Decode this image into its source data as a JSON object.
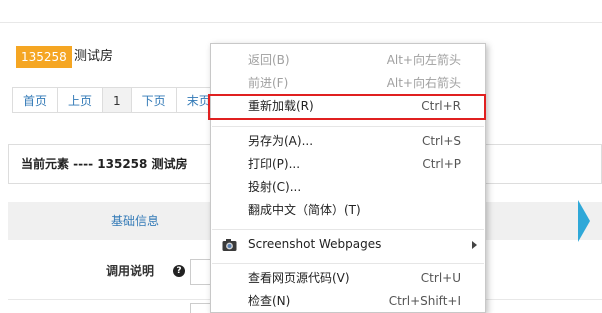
{
  "room": {
    "id_badge": "135258",
    "name": "测试房"
  },
  "pager": {
    "first": "首页",
    "prev": "上页",
    "current": "1",
    "next": "下页",
    "last_partial": "末页"
  },
  "current_element": {
    "text": "当前元素 ---- 135258 测试房"
  },
  "tabs": {
    "basic_info": "基础信息"
  },
  "form": {
    "usage_label": "调用说明",
    "help_icon_glyph": "?"
  },
  "context_menu": {
    "items": [
      {
        "label": "返回(B)",
        "shortcut": "Alt+向左箭头",
        "disabled": true
      },
      {
        "label": "前进(F)",
        "shortcut": "Alt+向右箭头",
        "disabled": true
      },
      {
        "label": "重新加载(R)",
        "shortcut": "Ctrl+R",
        "disabled": false,
        "highlighted": true
      },
      {
        "label": "另存为(A)...",
        "shortcut": "Ctrl+S",
        "disabled": false
      },
      {
        "label": "打印(P)...",
        "shortcut": "Ctrl+P",
        "disabled": false
      },
      {
        "label": "投射(C)...",
        "shortcut": "",
        "disabled": false
      },
      {
        "label": "翻成中文（简体）(T)",
        "shortcut": "",
        "disabled": false
      },
      {
        "label": "Screenshot Webpages",
        "shortcut": "",
        "disabled": false,
        "icon": "camera-icon",
        "submenu": true
      },
      {
        "label": "查看网页源代码(V)",
        "shortcut": "Ctrl+U",
        "disabled": false
      },
      {
        "label": "检查(N)",
        "shortcut": "Ctrl+Shift+I",
        "disabled": false
      }
    ]
  },
  "colors": {
    "badge": "#f5a623",
    "link": "#337ab7",
    "highlight_border": "#e02020",
    "tab_accent": "#2fa8d8"
  }
}
